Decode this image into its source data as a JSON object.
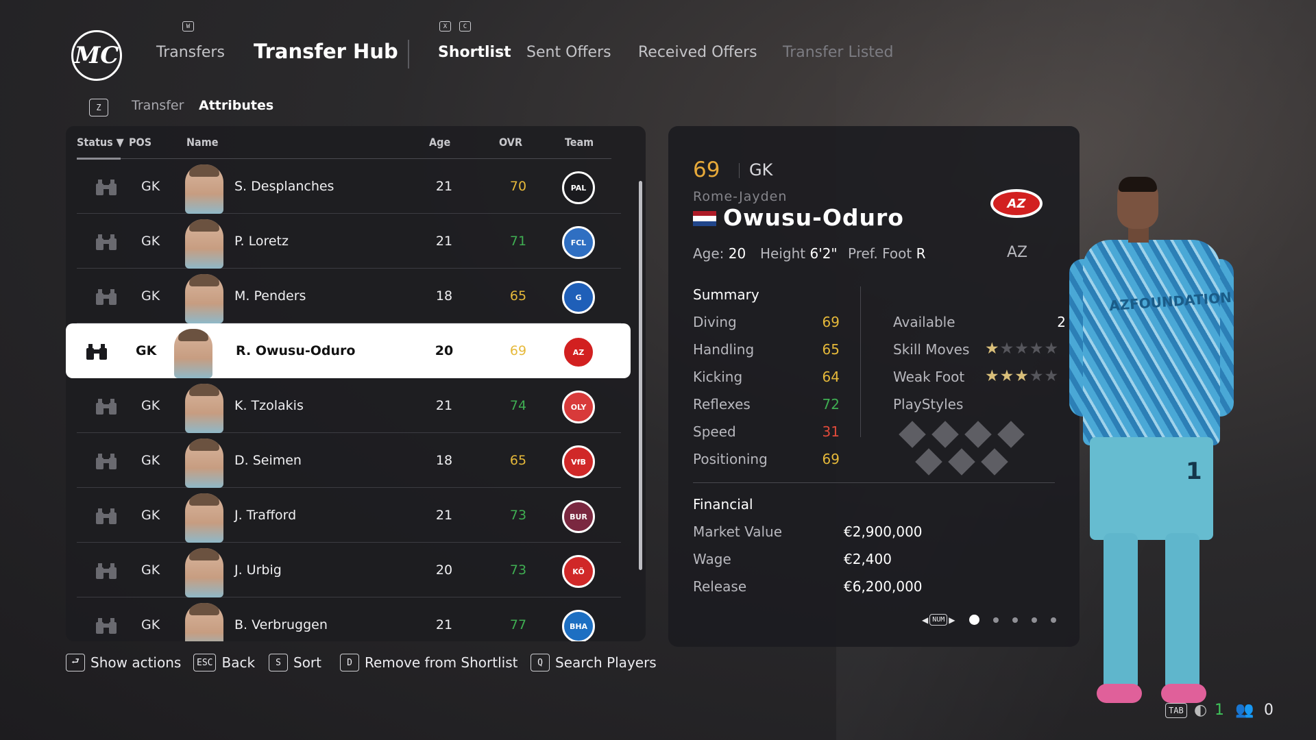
{
  "nav": {
    "logo": "MC",
    "key_w": "W",
    "key_x": "X",
    "key_c": "C",
    "transfers": "Transfers",
    "transfer_hub": "Transfer Hub",
    "shortlist": "Shortlist",
    "sent_offers": "Sent Offers",
    "received_offers": "Received Offers",
    "transfer_listed": "Transfer Listed"
  },
  "subnav": {
    "key": "Z",
    "transfer": "Transfer",
    "attributes": "Attributes"
  },
  "list": {
    "headers": {
      "status": "Status ▼",
      "pos": "POS",
      "name": "Name",
      "age": "Age",
      "ovr": "OVR",
      "team": "Team"
    },
    "rows": [
      {
        "pos": "GK",
        "name": "S. Desplanches",
        "age": "21",
        "ovr": "70",
        "ovr_color": "#e6b93a",
        "crest": "PAL",
        "crest_bg": "#1a1a1e",
        "crest_fg": "#ffffff"
      },
      {
        "pos": "GK",
        "name": "P. Loretz",
        "age": "21",
        "ovr": "71",
        "ovr_color": "#3fae52",
        "crest": "FCL",
        "crest_bg": "#2f6fc2",
        "crest_fg": "#ffffff"
      },
      {
        "pos": "GK",
        "name": "M. Penders",
        "age": "18",
        "ovr": "65",
        "ovr_color": "#e6b93a",
        "crest": "G",
        "crest_bg": "#1f5fb8",
        "crest_fg": "#ffffff"
      },
      {
        "pos": "GK",
        "name": "R. Owusu-Oduro",
        "age": "20",
        "ovr": "69",
        "ovr_color": "#e6b93a",
        "crest": "AZ",
        "crest_bg": "#d22020",
        "crest_fg": "#ffffff"
      },
      {
        "pos": "GK",
        "name": "K. Tzolakis",
        "age": "21",
        "ovr": "74",
        "ovr_color": "#3fae52",
        "crest": "OLY",
        "crest_bg": "#d83a3a",
        "crest_fg": "#ffffff"
      },
      {
        "pos": "GK",
        "name": "D. Seimen",
        "age": "18",
        "ovr": "65",
        "ovr_color": "#e6b93a",
        "crest": "VfB",
        "crest_bg": "#d02828",
        "crest_fg": "#ffffff"
      },
      {
        "pos": "GK",
        "name": "J. Trafford",
        "age": "21",
        "ovr": "73",
        "ovr_color": "#3fae52",
        "crest": "BUR",
        "crest_bg": "#7a2840",
        "crest_fg": "#ffffff"
      },
      {
        "pos": "GK",
        "name": "J. Urbig",
        "age": "20",
        "ovr": "73",
        "ovr_color": "#3fae52",
        "crest": "KÖ",
        "crest_bg": "#d02828",
        "crest_fg": "#ffffff"
      },
      {
        "pos": "GK",
        "name": "B. Verbruggen",
        "age": "21",
        "ovr": "77",
        "ovr_color": "#3fae52",
        "crest": "BHA",
        "crest_bg": "#1d6fc2",
        "crest_fg": "#ffffff"
      }
    ],
    "selected_index": 3
  },
  "hints": {
    "show_actions_key": "⮐",
    "show_actions": "Show actions",
    "back_key": "ESC",
    "back": "Back",
    "sort_key": "S",
    "sort": "Sort",
    "remove_key": "D",
    "remove": "Remove from Shortlist",
    "search_key": "Q",
    "search": "Search Players"
  },
  "detail": {
    "ovr": "69",
    "pos": "GK",
    "first_name": "Rome-Jayden",
    "last_name": "Owusu-Oduro",
    "flag_colors": [
      "#ae1c28",
      "#ffffff",
      "#21468b"
    ],
    "club_crest": "AZ",
    "age_label": "Age:",
    "age": "20",
    "height_label": "Height",
    "height": "6'2\"",
    "foot_label": "Pref. Foot",
    "foot": "R",
    "team": "AZ",
    "summary_title": "Summary",
    "attributes": [
      {
        "label": "Diving",
        "value": "69",
        "color": "#e6b93a"
      },
      {
        "label": "Handling",
        "value": "65",
        "color": "#e6b93a"
      },
      {
        "label": "Kicking",
        "value": "64",
        "color": "#e6b93a"
      },
      {
        "label": "Reflexes",
        "value": "72",
        "color": "#3fae52"
      },
      {
        "label": "Speed",
        "value": "31",
        "color": "#e04a3a"
      },
      {
        "label": "Positioning",
        "value": "69",
        "color": "#e6b93a"
      }
    ],
    "available_label": "Available",
    "available": "2",
    "skill_moves_label": "Skill Moves",
    "skill_moves": 1,
    "weak_foot_label": "Weak Foot",
    "weak_foot": 3,
    "playstyles_label": "PlayStyles",
    "financial_title": "Financial",
    "market_value_label": "Market Value",
    "market_value": "€2,900,000",
    "wage_label": "Wage",
    "wage": "€2,400",
    "release_label": "Release",
    "release": "€6,200,000",
    "pager_key": "NUM",
    "page_count": 5,
    "current_page": 1
  },
  "player_model": {
    "shirt_text": "AZFOUNDATION",
    "number": "1"
  },
  "status_bar": {
    "tab_key": "TAB",
    "count_a": "1",
    "count_b": "0"
  }
}
